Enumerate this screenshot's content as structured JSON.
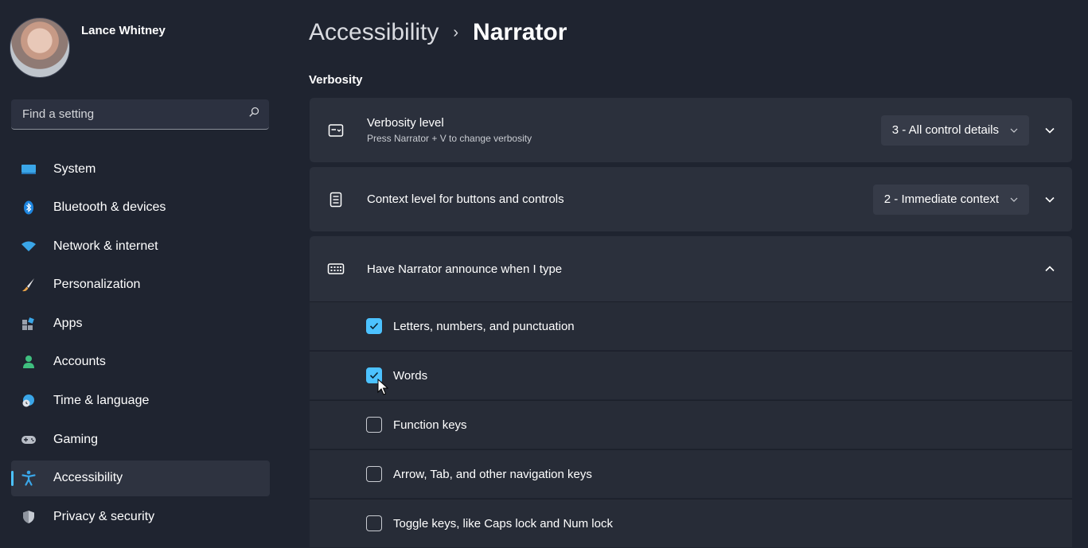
{
  "profile": {
    "name": "Lance Whitney"
  },
  "search": {
    "placeholder": "Find a setting",
    "icon": "search-icon"
  },
  "sidebar": {
    "items": [
      {
        "label": "System",
        "icon": "system-icon",
        "active": false
      },
      {
        "label": "Bluetooth & devices",
        "icon": "bluetooth-icon",
        "active": false
      },
      {
        "label": "Network & internet",
        "icon": "network-icon",
        "active": false
      },
      {
        "label": "Personalization",
        "icon": "brush-icon",
        "active": false
      },
      {
        "label": "Apps",
        "icon": "apps-icon",
        "active": false
      },
      {
        "label": "Accounts",
        "icon": "person-icon",
        "active": false
      },
      {
        "label": "Time & language",
        "icon": "globe-clock-icon",
        "active": false
      },
      {
        "label": "Gaming",
        "icon": "gamepad-icon",
        "active": false
      },
      {
        "label": "Accessibility",
        "icon": "accessibility-icon",
        "active": true
      },
      {
        "label": "Privacy & security",
        "icon": "shield-icon",
        "active": false
      }
    ]
  },
  "header": {
    "parent": "Accessibility",
    "separator": "›",
    "current": "Narrator"
  },
  "section": {
    "title": "Verbosity"
  },
  "verbosity_level": {
    "title": "Verbosity level",
    "subtitle": "Press Narrator + V to change verbosity",
    "value": "3 - All control details"
  },
  "context_level": {
    "title": "Context level for buttons and controls",
    "value": "2 - Immediate context"
  },
  "announce": {
    "title": "Have Narrator announce when I type",
    "options": [
      {
        "label": "Letters, numbers, and punctuation",
        "checked": true
      },
      {
        "label": "Words",
        "checked": true
      },
      {
        "label": "Function keys",
        "checked": false
      },
      {
        "label": "Arrow, Tab, and other navigation keys",
        "checked": false
      },
      {
        "label": "Toggle keys, like Caps lock and Num lock",
        "checked": false
      }
    ]
  },
  "colors": {
    "accent": "#4cc2ff",
    "background": "#1f2430",
    "card": "#2b303c"
  }
}
